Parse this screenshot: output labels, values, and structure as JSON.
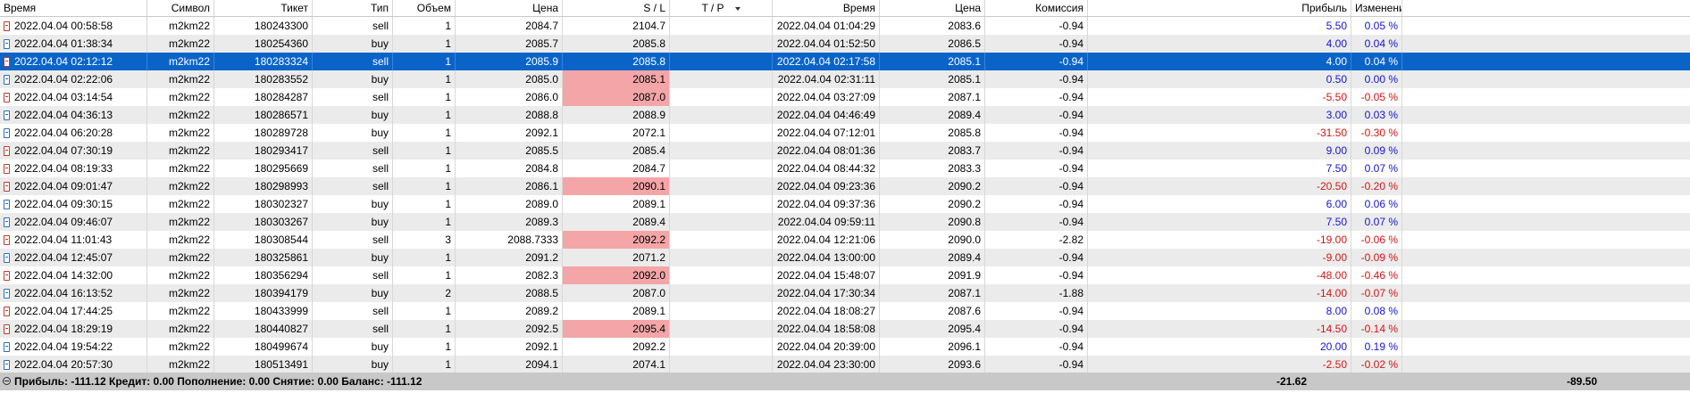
{
  "columns": [
    {
      "key": "open_time",
      "label": "Время"
    },
    {
      "key": "symbol",
      "label": "Символ"
    },
    {
      "key": "ticket",
      "label": "Тикет"
    },
    {
      "key": "type",
      "label": "Тип"
    },
    {
      "key": "volume",
      "label": "Объем"
    },
    {
      "key": "open_price",
      "label": "Цена"
    },
    {
      "key": "sl",
      "label": "S / L"
    },
    {
      "key": "tp",
      "label": "T / P"
    },
    {
      "key": "close_time",
      "label": "Время"
    },
    {
      "key": "close_price",
      "label": "Цена"
    },
    {
      "key": "commission",
      "label": "Комиссия"
    },
    {
      "key": "profit",
      "label": "Прибыль"
    },
    {
      "key": "change",
      "label": "Изменение"
    }
  ],
  "rows": [
    {
      "open_time": "2022.04.04 00:58:58",
      "symbol": "m2km22",
      "ticket": "180243300",
      "type": "sell",
      "volume": "1",
      "open_price": "2084.7",
      "sl": "2104.7",
      "tp": "",
      "close_time": "2022.04.04 01:04:29",
      "close_price": "2083.6",
      "commission": "-0.94",
      "profit": "5.50",
      "change": "0.05 %",
      "sl_hit": false,
      "selected": false
    },
    {
      "open_time": "2022.04.04 01:38:34",
      "symbol": "m2km22",
      "ticket": "180254360",
      "type": "buy",
      "volume": "1",
      "open_price": "2085.7",
      "sl": "2085.8",
      "tp": "",
      "close_time": "2022.04.04 01:52:50",
      "close_price": "2086.5",
      "commission": "-0.94",
      "profit": "4.00",
      "change": "0.04 %",
      "sl_hit": false,
      "selected": false
    },
    {
      "open_time": "2022.04.04 02:12:12",
      "symbol": "m2km22",
      "ticket": "180283324",
      "type": "sell",
      "volume": "1",
      "open_price": "2085.9",
      "sl": "2085.8",
      "tp": "",
      "close_time": "2022.04.04 02:17:58",
      "close_price": "2085.1",
      "commission": "-0.94",
      "profit": "4.00",
      "change": "0.04 %",
      "sl_hit": false,
      "selected": true
    },
    {
      "open_time": "2022.04.04 02:22:06",
      "symbol": "m2km22",
      "ticket": "180283552",
      "type": "buy",
      "volume": "1",
      "open_price": "2085.0",
      "sl": "2085.1",
      "tp": "",
      "close_time": "2022.04.04 02:31:11",
      "close_price": "2085.1",
      "commission": "-0.94",
      "profit": "0.50",
      "change": "0.00 %",
      "sl_hit": true,
      "selected": false
    },
    {
      "open_time": "2022.04.04 03:14:54",
      "symbol": "m2km22",
      "ticket": "180284287",
      "type": "sell",
      "volume": "1",
      "open_price": "2086.0",
      "sl": "2087.0",
      "tp": "",
      "close_time": "2022.04.04 03:27:09",
      "close_price": "2087.1",
      "commission": "-0.94",
      "profit": "-5.50",
      "change": "-0.05 %",
      "sl_hit": true,
      "selected": false
    },
    {
      "open_time": "2022.04.04 04:36:13",
      "symbol": "m2km22",
      "ticket": "180286571",
      "type": "buy",
      "volume": "1",
      "open_price": "2088.8",
      "sl": "2088.9",
      "tp": "",
      "close_time": "2022.04.04 04:46:49",
      "close_price": "2089.4",
      "commission": "-0.94",
      "profit": "3.00",
      "change": "0.03 %",
      "sl_hit": false,
      "selected": false
    },
    {
      "open_time": "2022.04.04 06:20:28",
      "symbol": "m2km22",
      "ticket": "180289728",
      "type": "buy",
      "volume": "1",
      "open_price": "2092.1",
      "sl": "2072.1",
      "tp": "",
      "close_time": "2022.04.04 07:12:01",
      "close_price": "2085.8",
      "commission": "-0.94",
      "profit": "-31.50",
      "change": "-0.30 %",
      "sl_hit": false,
      "selected": false
    },
    {
      "open_time": "2022.04.04 07:30:19",
      "symbol": "m2km22",
      "ticket": "180293417",
      "type": "sell",
      "volume": "1",
      "open_price": "2085.5",
      "sl": "2085.4",
      "tp": "",
      "close_time": "2022.04.04 08:01:36",
      "close_price": "2083.7",
      "commission": "-0.94",
      "profit": "9.00",
      "change": "0.09 %",
      "sl_hit": false,
      "selected": false
    },
    {
      "open_time": "2022.04.04 08:19:33",
      "symbol": "m2km22",
      "ticket": "180295669",
      "type": "sell",
      "volume": "1",
      "open_price": "2084.8",
      "sl": "2084.7",
      "tp": "",
      "close_time": "2022.04.04 08:44:32",
      "close_price": "2083.3",
      "commission": "-0.94",
      "profit": "7.50",
      "change": "0.07 %",
      "sl_hit": false,
      "selected": false
    },
    {
      "open_time": "2022.04.04 09:01:47",
      "symbol": "m2km22",
      "ticket": "180298993",
      "type": "sell",
      "volume": "1",
      "open_price": "2086.1",
      "sl": "2090.1",
      "tp": "",
      "close_time": "2022.04.04 09:23:36",
      "close_price": "2090.2",
      "commission": "-0.94",
      "profit": "-20.50",
      "change": "-0.20 %",
      "sl_hit": true,
      "selected": false
    },
    {
      "open_time": "2022.04.04 09:30:15",
      "symbol": "m2km22",
      "ticket": "180302327",
      "type": "buy",
      "volume": "1",
      "open_price": "2089.0",
      "sl": "2089.1",
      "tp": "",
      "close_time": "2022.04.04 09:37:36",
      "close_price": "2090.2",
      "commission": "-0.94",
      "profit": "6.00",
      "change": "0.06 %",
      "sl_hit": false,
      "selected": false
    },
    {
      "open_time": "2022.04.04 09:46:07",
      "symbol": "m2km22",
      "ticket": "180303267",
      "type": "buy",
      "volume": "1",
      "open_price": "2089.3",
      "sl": "2089.4",
      "tp": "",
      "close_time": "2022.04.04 09:59:11",
      "close_price": "2090.8",
      "commission": "-0.94",
      "profit": "7.50",
      "change": "0.07 %",
      "sl_hit": false,
      "selected": false
    },
    {
      "open_time": "2022.04.04 11:01:43",
      "symbol": "m2km22",
      "ticket": "180308544",
      "type": "sell",
      "volume": "3",
      "open_price": "2088.7333",
      "sl": "2092.2",
      "tp": "",
      "close_time": "2022.04.04 12:21:06",
      "close_price": "2090.0",
      "commission": "-2.82",
      "profit": "-19.00",
      "change": "-0.06 %",
      "sl_hit": true,
      "selected": false
    },
    {
      "open_time": "2022.04.04 12:45:07",
      "symbol": "m2km22",
      "ticket": "180325861",
      "type": "buy",
      "volume": "1",
      "open_price": "2091.2",
      "sl": "2071.2",
      "tp": "",
      "close_time": "2022.04.04 13:00:00",
      "close_price": "2089.4",
      "commission": "-0.94",
      "profit": "-9.00",
      "change": "-0.09 %",
      "sl_hit": false,
      "selected": false
    },
    {
      "open_time": "2022.04.04 14:32:00",
      "symbol": "m2km22",
      "ticket": "180356294",
      "type": "sell",
      "volume": "1",
      "open_price": "2082.3",
      "sl": "2092.0",
      "tp": "",
      "close_time": "2022.04.04 15:48:07",
      "close_price": "2091.9",
      "commission": "-0.94",
      "profit": "-48.00",
      "change": "-0.46 %",
      "sl_hit": true,
      "selected": false
    },
    {
      "open_time": "2022.04.04 16:13:52",
      "symbol": "m2km22",
      "ticket": "180394179",
      "type": "buy",
      "volume": "2",
      "open_price": "2088.5",
      "sl": "2087.0",
      "tp": "",
      "close_time": "2022.04.04 17:30:34",
      "close_price": "2087.1",
      "commission": "-1.88",
      "profit": "-14.00",
      "change": "-0.07 %",
      "sl_hit": false,
      "selected": false
    },
    {
      "open_time": "2022.04.04 17:44:25",
      "symbol": "m2km22",
      "ticket": "180433999",
      "type": "sell",
      "volume": "1",
      "open_price": "2089.2",
      "sl": "2089.1",
      "tp": "",
      "close_time": "2022.04.04 18:08:27",
      "close_price": "2087.6",
      "commission": "-0.94",
      "profit": "8.00",
      "change": "0.08 %",
      "sl_hit": false,
      "selected": false
    },
    {
      "open_time": "2022.04.04 18:29:19",
      "symbol": "m2km22",
      "ticket": "180440827",
      "type": "sell",
      "volume": "1",
      "open_price": "2092.5",
      "sl": "2095.4",
      "tp": "",
      "close_time": "2022.04.04 18:58:08",
      "close_price": "2095.4",
      "commission": "-0.94",
      "profit": "-14.50",
      "change": "-0.14 %",
      "sl_hit": true,
      "selected": false
    },
    {
      "open_time": "2022.04.04 19:54:22",
      "symbol": "m2km22",
      "ticket": "180499674",
      "type": "buy",
      "volume": "1",
      "open_price": "2092.1",
      "sl": "2092.2",
      "tp": "",
      "close_time": "2022.04.04 20:39:00",
      "close_price": "2096.1",
      "commission": "-0.94",
      "profit": "20.00",
      "change": "0.19 %",
      "sl_hit": false,
      "selected": false
    },
    {
      "open_time": "2022.04.04 20:57:30",
      "symbol": "m2km22",
      "ticket": "180513491",
      "type": "buy",
      "volume": "1",
      "open_price": "2094.1",
      "sl": "2074.1",
      "tp": "",
      "close_time": "2022.04.04 23:30:00",
      "close_price": "2093.6",
      "commission": "-0.94",
      "profit": "-2.50",
      "change": "-0.02 %",
      "sl_hit": false,
      "selected": false
    }
  ],
  "summary": {
    "text": "Прибыль: -111.12  Кредит: 0.00  Пополнение: 0.00  Снятие: 0.00  Баланс: -111.12",
    "commission_total": "-21.62",
    "profit_total": "-89.50"
  },
  "colors": {
    "selected_row": "#0a64c8",
    "sl_highlight": "#f4a5a7",
    "profit_positive": "#1515d0",
    "profit_negative": "#d01515",
    "summary_bar": "#c8c8c8"
  }
}
